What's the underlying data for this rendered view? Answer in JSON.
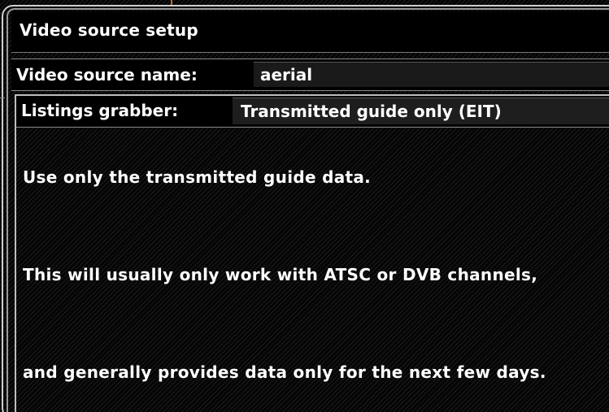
{
  "dialog": {
    "title": "Video source setup"
  },
  "video_source": {
    "label": "Video source name:",
    "value": "aerial"
  },
  "listings_grabber": {
    "label": "Listings grabber:",
    "value": "Transmitted guide only (EIT)"
  },
  "description": {
    "lines": [
      "Use only the transmitted guide data.",
      "This will usually only work with ATSC or DVB channels,",
      "and generally provides data only for the next few days."
    ]
  }
}
